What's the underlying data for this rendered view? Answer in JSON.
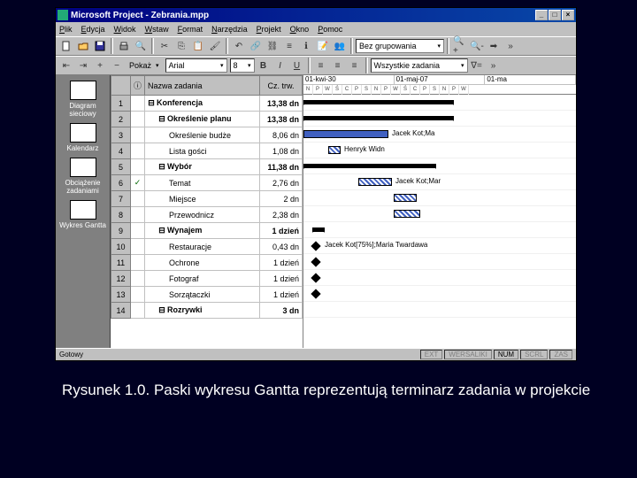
{
  "title": "Microsoft Project - Zebrania.mpp",
  "menus": [
    "Plik",
    "Edycja",
    "Widok",
    "Wstaw",
    "Format",
    "Narzędzia",
    "Projekt",
    "Okno",
    "Pomoc"
  ],
  "toolbar1": {
    "grouping_combo": "Bez grupowania"
  },
  "toolbar2": {
    "show_label": "Pokaż",
    "font_combo": "Arial",
    "size_combo": "8",
    "filter_combo": "Wszystkie zadania"
  },
  "viewbar": [
    {
      "label": "Diagram sieciowy"
    },
    {
      "label": "Kalendarz"
    },
    {
      "label": "Obciążenie zadaniami"
    },
    {
      "label": "Wykres Gantta"
    }
  ],
  "columns": {
    "info": "ⓘ",
    "name": "Nazwa zadania",
    "dur": "Cz. trw."
  },
  "timeline": {
    "weeks": [
      "01-kwi-30",
      "01-maj-07",
      "01-ma"
    ],
    "days": [
      "N",
      "P",
      "W",
      "Ś",
      "C",
      "P",
      "S",
      "N",
      "P",
      "W",
      "Ś",
      "C",
      "P",
      "S",
      "N",
      "P",
      "W"
    ]
  },
  "tasks": [
    {
      "n": 1,
      "name": "Konferencja",
      "dur": "13,38 dn",
      "lvl": 0,
      "sum": true,
      "bar": [
        0,
        170
      ]
    },
    {
      "n": 2,
      "name": "Określenie planu",
      "dur": "13,38 dn",
      "lvl": 1,
      "sum": true,
      "bar": [
        0,
        170
      ]
    },
    {
      "n": 3,
      "name": "Określenie budże",
      "dur": "8,06 dn",
      "lvl": 2,
      "bar": [
        0,
        96
      ],
      "label": "Jacek Kot;Ma"
    },
    {
      "n": 4,
      "name": "Lista gości",
      "dur": "1,08 dn",
      "lvl": 2,
      "bar": [
        28,
        42
      ],
      "hatch": true,
      "label": "Henryk Widn"
    },
    {
      "n": 5,
      "name": "Wybór",
      "dur": "11,38 dn",
      "lvl": 1,
      "sum": true,
      "bar": [
        0,
        150
      ]
    },
    {
      "n": 6,
      "name": "Temat",
      "dur": "2,76 dn",
      "lvl": 2,
      "chk": true,
      "bar": [
        62,
        100
      ],
      "hatch": true,
      "label": "Jacek Kot;Mar"
    },
    {
      "n": 7,
      "name": "Miejsce",
      "dur": "2 dn",
      "lvl": 2,
      "bar": [
        102,
        128
      ],
      "hatch": true
    },
    {
      "n": 8,
      "name": "Przewodnicz",
      "dur": "2,38 dn",
      "lvl": 2,
      "bar": [
        102,
        132
      ],
      "hatch": true
    },
    {
      "n": 9,
      "name": "Wynajem",
      "dur": "1 dzień",
      "lvl": 1,
      "sum": true,
      "bar": [
        10,
        24
      ]
    },
    {
      "n": 10,
      "name": "Restauracje",
      "dur": "0,43 dn",
      "lvl": 2,
      "ms": 10,
      "label": "Jacek Kot[75%];Maria Twardawa"
    },
    {
      "n": 11,
      "name": "Ochrone",
      "dur": "1 dzień",
      "lvl": 2,
      "ms": 10
    },
    {
      "n": 12,
      "name": "Fotograf",
      "dur": "1 dzień",
      "lvl": 2,
      "ms": 10
    },
    {
      "n": 13,
      "name": "Sorzątaczki",
      "dur": "1 dzień",
      "lvl": 2,
      "ms": 10
    },
    {
      "n": 14,
      "name": "Rozrywki",
      "dur": "3 dn",
      "lvl": 1,
      "sum": true
    }
  ],
  "status": {
    "ready": "Gotowy",
    "cells": [
      "EXT",
      "WERSALIKI",
      "NUM",
      "SCRL",
      "ZAS"
    ]
  },
  "caption": "Rysunek 1.0. Paski wykresu Gantta reprezentują terminarz zadania w projekcie"
}
